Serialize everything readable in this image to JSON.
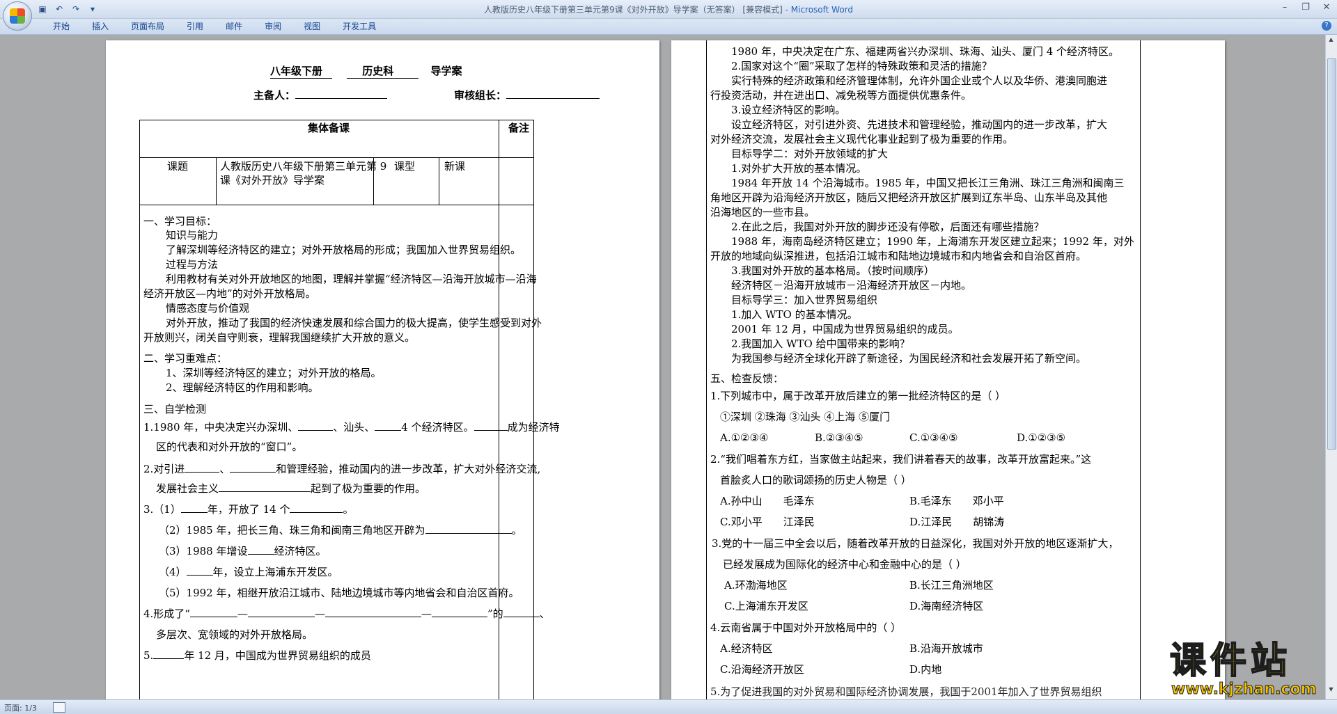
{
  "window": {
    "title": "人教版历史八年级下册第三单元第9课《对外开放》导学案（无答案） [兼容模式] - ",
    "app_name": "Microsoft Word"
  },
  "ribbon": {
    "tabs": [
      "开始",
      "插入",
      "页面布局",
      "引用",
      "邮件",
      "审阅",
      "视图",
      "开发工具"
    ]
  },
  "status": {
    "page": "页面: 1/3"
  },
  "page1": {
    "header_line": "八年级下册",
    "subject": "历史科",
    "doc_type": "导学案",
    "preparer_label": "主备人：",
    "reviewer_label": "审核组长：",
    "table": {
      "group_prep": "集体备课",
      "notes": "备注",
      "topic_label": "课题",
      "topic_value_1": "人教版历史八年级下册第三单元第 9",
      "topic_value_2": "课《对外开放》导学案",
      "type_label": "课型",
      "type_value": "新课"
    },
    "lines": [
      "一、学习目标：",
      "知识与能力",
      "了解深圳等经济特区的建立；对外开放格局的形成；我国加入世界贸易组织。",
      "过程与方法",
      "利用教材有关对外开放地区的地图，理解并掌握“经济特区—沿海开放城市—沿海",
      "经济开放区—内地”的对外开放格局。",
      "情感态度与价值观",
      "对外开放，推动了我国的经济快速发展和综合国力的极大提高，使学生感受到对外",
      "开放则兴，闭关自守则衰，理解我国继续扩大开放的意义。",
      "二、学习重难点：",
      "1、深圳等经济特区的建立；对外开放的格局。",
      "2、理解经济特区的作用和影响。",
      "三、自学检测"
    ],
    "q1a": "1.1980 年，中央决定兴办深圳、",
    "q1b": "、汕头、",
    "q1c": "4 个经济特区。",
    "q1d": "成为经济特",
    "q1e": "区的代表和对外开放的“窗口”。",
    "q2a": "2.对引进",
    "q2b": "、",
    "q2c": "和管理经验，推动国内的进一步改革，扩大对外经济交流,",
    "q2d": "发展社会主义",
    "q2e": "起到了极为重要的作用。",
    "q3a": "3.（1）",
    "q3b": "年，开放了 14 个",
    "q3c": "。",
    "q3_2a": "（2）1985 年，把长三角、珠三角和闽南三角地区开辟为",
    "q3_2b": "。",
    "q3_3a": "（3）1988 年增设",
    "q3_3b": "经济特区。",
    "q3_4a": "（4）",
    "q3_4b": "年，设立上海浦东开发区。",
    "q3_5": "（5）1992 年，相继开放沿江城市、陆地边境城市等内地省会和自治区首府。",
    "q4a": "4.形成了“",
    "q4b": "—",
    "q4c": "—",
    "q4d": "—",
    "q4e": "”的",
    "q4f": "、",
    "q4g": "多层次、宽领域的对外开放格局。",
    "q5a": "5.",
    "q5b": "年 12 月，中国成为世界贸易组织的成员"
  },
  "page2": {
    "lines": [
      "1980 年，中央决定在广东、福建两省兴办深圳、珠海、汕头、厦门 4 个经济特区。",
      "2.国家对这个“圈”采取了怎样的特殊政策和灵活的措施？",
      "实行特殊的经济政策和经济管理体制，允许外国企业或个人以及华侨、港澳同胞进",
      "行投资活动，并在进出口、减免税等方面提供优惠条件。",
      "3.设立经济特区的影响。",
      "设立经济特区，对引进外资、先进技术和管理经验，推动国内的进一步改革，扩大",
      "对外经济交流，发展社会主义现代化事业起到了极为重要的作用。",
      "目标导学二：对外开放领域的扩大",
      "1.对外扩大开放的基本情况。",
      "1984 年开放 14 个沿海城市。1985 年，中国又把长江三角洲、珠江三角洲和闽南三",
      "角地区开辟为沿海经济开放区，随后又把经济开放区扩展到辽东半岛、山东半岛及其他",
      "沿海地区的一些市县。",
      "2.在此之后，我国对外开放的脚步还没有停歇，后面还有哪些措施？",
      "1988 年，海南岛经济特区建立；1990 年，上海浦东开发区建立起来；1992 年，对外",
      "开放的地域向纵深推进，包括沿江城市和陆地边境城市和内地省会和自治区首府。",
      "3.我国对外开放的基本格局。（按时间顺序）",
      "经济特区－沿海开放城市－沿海经济开放区－内地。",
      "目标导学三：加入世界贸易组织",
      "1.加入 WTO 的基本情况。",
      "2001 年 12 月，中国成为世界贸易组织的成员。",
      "2.我国加入 WTO 给中国带来的影响？",
      "为我国参与经济全球化开辟了新途径，为国民经济和社会发展开拓了新空间。",
      "五、检查反馈："
    ],
    "q1": "1.下列城市中，属于改革开放后建立的第一批经济特区的是（        ）",
    "q1_items": "①深圳 ②珠海 ③汕头 ④上海 ⑤厦门",
    "q1_opts": [
      "A.①②③④",
      "B.②③④⑤",
      "C.①③④⑤",
      "D.①②③⑤"
    ],
    "q2a": "2.“我们唱着东方红，当家做主站起来，我们讲着春天的故事，改革开放富起来。”这",
    "q2b": "首脍炙人口的歌词颂扬的历史人物是（        ）",
    "q2_opts": [
      "A.孙中山　　毛泽东",
      "B.毛泽东　　邓小平",
      "C.邓小平　　江泽民",
      "D.江泽民　　胡锦涛"
    ],
    "q3a": "3.党的十一届三中全会以后，随着改革开放的日益深化，我国对外开放的地区逐渐扩大，",
    "q3b": "已经发展成为国际化的经济中心和金融中心的是（        ）",
    "q3_opts": [
      "A.环渤海地区",
      "B.长江三角洲地区",
      "C.上海浦东开发区",
      "D.海南经济特区"
    ],
    "q4": "4.云南省属于中国对外开放格局中的（        ）",
    "q4_opts": [
      "A.经济特区",
      "B.沿海开放城市",
      "C.沿海经济开放区",
      "D.内地"
    ],
    "q5_partial": "5.为了促进我国的对外贸易和国际经济协调发展，我国于2001年加入了世界贸易组织"
  },
  "watermark": {
    "title": "课件站",
    "url": "www.kjzhan.com"
  }
}
